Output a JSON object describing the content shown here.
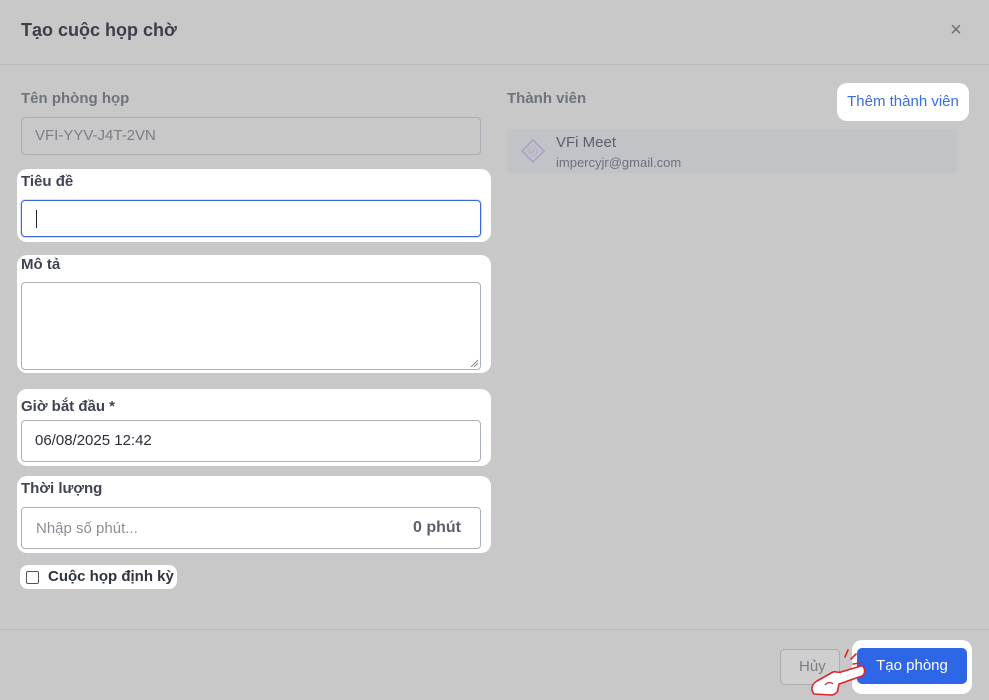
{
  "dialog": {
    "title": "Tạo cuộc họp chờ",
    "close_symbol": "×"
  },
  "form": {
    "room_name": {
      "label": "Tên phòng họp",
      "value": "VFI-YYV-J4T-2VN"
    },
    "title_field": {
      "label": "Tiêu đề",
      "value": ""
    },
    "description": {
      "label": "Mô tả",
      "value": ""
    },
    "start_time": {
      "label": "Giờ bắt đầu *",
      "value": "06/08/2025 12:42"
    },
    "duration": {
      "label": "Thời lượng",
      "placeholder": "Nhập số phút...",
      "suffix": "0 phút"
    },
    "recurring": {
      "label": "Cuộc họp định kỳ",
      "checked": false
    }
  },
  "members": {
    "label": "Thành viên",
    "add_button": "Thêm thành viên",
    "items": [
      {
        "name": "VFi Meet",
        "email": "impercyjr@gmail.com",
        "icon": "vfi-logo-icon"
      }
    ]
  },
  "footer": {
    "cancel_label": "Hủy",
    "create_label": "Tạo phòng",
    "pointer_icon": "pointing-hand-icon"
  }
}
